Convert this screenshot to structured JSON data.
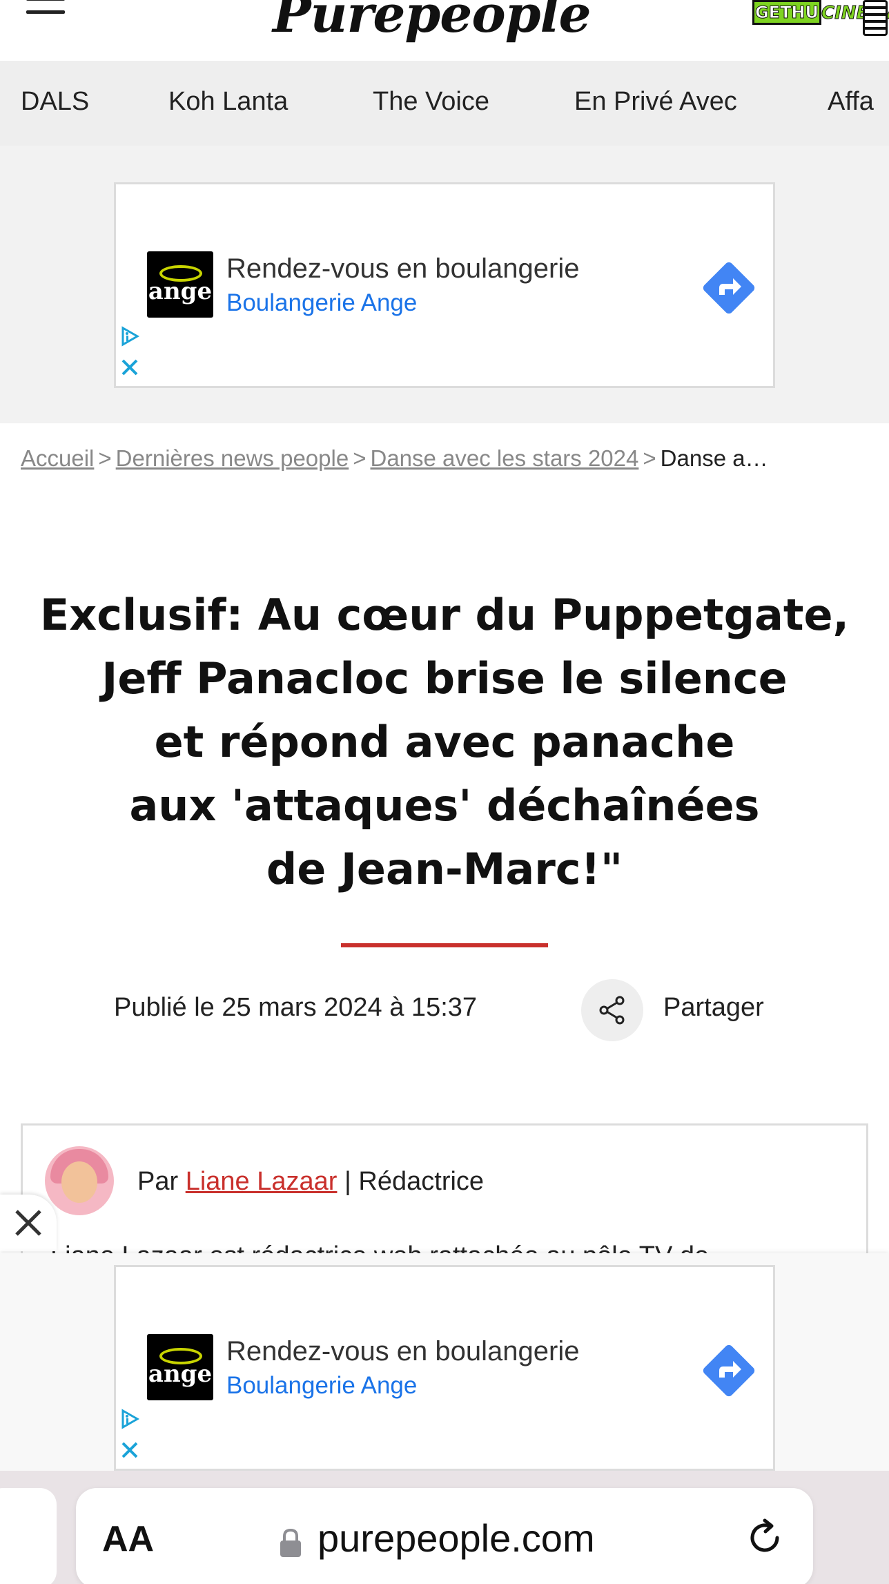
{
  "header": {
    "logo_text": "Purepeople",
    "badge_left": "GETHU",
    "badge_right": "CINEMA"
  },
  "categories": [
    "DALS",
    "Koh Lanta",
    "The Voice",
    "En Privé Avec",
    "Affa"
  ],
  "ad_top": {
    "title": "Rendez-vous en boulangerie",
    "advertiser": "Boulangerie Ange",
    "logo_word": "ange"
  },
  "breadcrumb": {
    "items": [
      "Accueil",
      "Dernières news people",
      "Danse avec les stars 2024"
    ],
    "current": "Danse a…",
    "separator": ">"
  },
  "article": {
    "title_lines": [
      "Exclusif: Au cœur du Puppetgate,",
      "Jeff Panacloc brise le silence",
      "et répond avec panache",
      "aux 'attaques' déchaînées",
      "de Jean-Marc!\""
    ],
    "published": "Publié le 25 mars 2024 à 15:37",
    "share_label": "Partager",
    "accent_color": "#c9302c"
  },
  "author": {
    "prefix": "Par",
    "name": "Liane Lazaar",
    "role": "| Rédactrice",
    "bio_partial": "Liane Lazaar est rédactrice web rattachée au pôle TV de"
  },
  "ad_sticky": {
    "title": "Rendez-vous en boulangerie",
    "advertiser": "Boulangerie Ange",
    "logo_word": "ange"
  },
  "browser": {
    "text_size_label": "AA",
    "url": "purepeople.com"
  }
}
